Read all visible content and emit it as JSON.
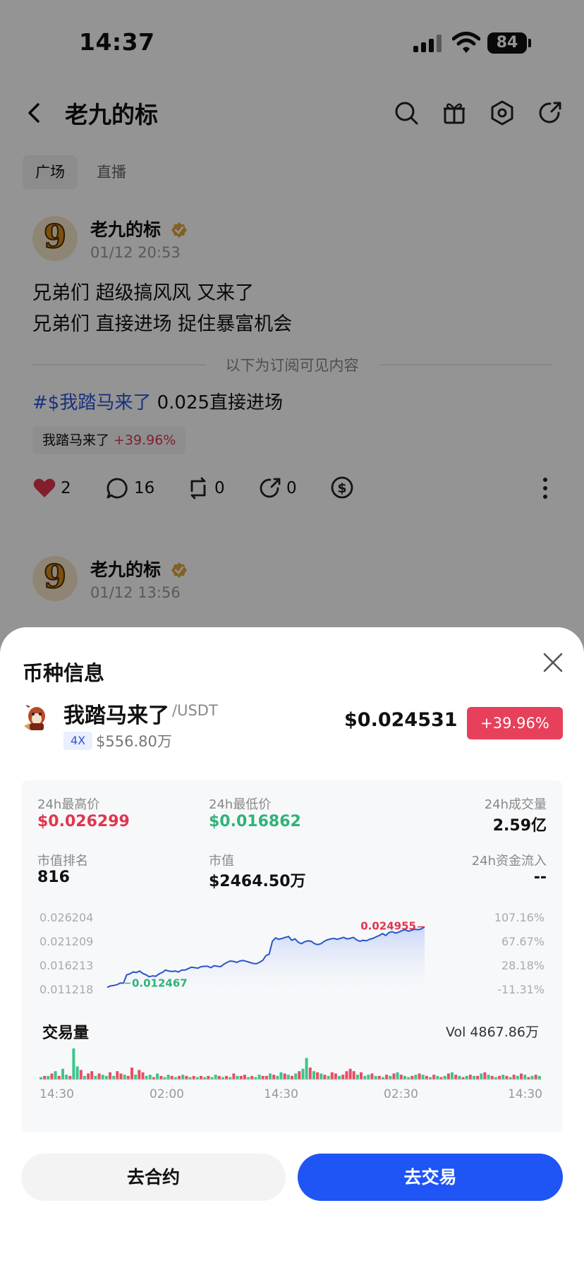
{
  "status_bar": {
    "time": "14:37",
    "battery": "84"
  },
  "header": {
    "title": "老九的标"
  },
  "tabs": [
    {
      "label": "广场",
      "active": true
    },
    {
      "label": "直播",
      "active": false
    }
  ],
  "posts": [
    {
      "author": "老九的标",
      "avatar_glyph": "9",
      "time": "01/12 20:53",
      "lines": [
        "兄弟们 超级搞风风 又来了",
        "兄弟们 直接进场 捉住暴富机会"
      ],
      "divider_text": "以下为订阅可见内容",
      "hashtag": "#$我踏马来了",
      "hashtag_suffix": " 0.025直接进场",
      "tag": {
        "name": "我踏马来了",
        "change": "+39.96%"
      },
      "stats": {
        "likes": "2",
        "comments": "16",
        "reposts": "0",
        "shares": "0"
      }
    },
    {
      "author": "老九的标",
      "avatar_glyph": "9",
      "time": "01/12 13:56"
    }
  ],
  "sheet": {
    "title": "币种信息",
    "coin": {
      "name": "我踏马来了",
      "pair": "/USDT",
      "leverage": "4X",
      "market_cap_short": "$556.80万",
      "price": "$0.024531",
      "change": "+39.96%"
    },
    "stats": {
      "high_label": "24h最高价",
      "high_value": "$0.026299",
      "low_label": "24h最低价",
      "low_value": "$0.016862",
      "volume_label": "24h成交量",
      "volume_value": "2.59亿",
      "rank_label": "市值排名",
      "rank_value": "816",
      "mcap_label": "市值",
      "mcap_value": "$2464.50万",
      "flow_label": "24h资金流入",
      "flow_value": "--"
    },
    "volume": {
      "title": "交易量",
      "text": "Vol 4867.86万"
    },
    "buttons": {
      "contract": "去合约",
      "trade": "去交易"
    }
  },
  "colors": {
    "up": "#e0364f",
    "down": "#2fb378",
    "accent": "#1f54f5",
    "line": "#2a55c8"
  },
  "chart_data": [
    {
      "type": "area",
      "y_ticks_left": [
        "0.026204",
        "0.021209",
        "0.016213",
        "0.011218"
      ],
      "y_ticks_right": [
        "107.16%",
        "67.67%",
        "28.18%",
        "-11.31%"
      ],
      "ylim": [
        0.011218,
        0.026204
      ],
      "annotations": [
        {
          "label": "0.024955",
          "kind": "high"
        },
        {
          "label": "0.012467",
          "kind": "low"
        }
      ],
      "series": [
        {
          "values": [
            0.0116,
            0.0119,
            0.012,
            0.01215,
            0.0125,
            0.01247,
            0.0142,
            0.0144,
            0.0148,
            0.0147,
            0.015,
            0.0145,
            0.0142,
            0.0138,
            0.014,
            0.0139,
            0.0144,
            0.0147,
            0.0152,
            0.015,
            0.0149,
            0.015,
            0.0148,
            0.0152,
            0.0152,
            0.0155,
            0.0158,
            0.0157,
            0.0156,
            0.0159,
            0.016,
            0.016,
            0.0157,
            0.0161,
            0.016,
            0.0159,
            0.0164,
            0.0168,
            0.0171,
            0.017,
            0.0168,
            0.0171,
            0.0172,
            0.017,
            0.0168,
            0.0166,
            0.0165,
            0.0168,
            0.0172,
            0.0182,
            0.0185,
            0.0212,
            0.0219,
            0.0216,
            0.0218,
            0.022,
            0.0222,
            0.0214,
            0.0217,
            0.021,
            0.0207,
            0.0211,
            0.0213,
            0.0212,
            0.0207,
            0.0205,
            0.0207,
            0.0212,
            0.0215,
            0.0217,
            0.0218,
            0.0216,
            0.0218,
            0.022,
            0.0217,
            0.0218,
            0.022,
            0.0215,
            0.0212,
            0.0214,
            0.0213,
            0.0216,
            0.0218,
            0.0221,
            0.0224,
            0.0228,
            0.0224,
            0.023,
            0.0232,
            0.0229,
            0.0231,
            0.0234,
            0.0236,
            0.0233,
            0.0235,
            0.0237,
            0.0236,
            0.0238,
            0.0242
          ]
        }
      ]
    },
    {
      "type": "bar",
      "title": "交易量",
      "x_tick_labels": [
        "14:30",
        "02:00",
        "14:30",
        "02:30",
        "14:30"
      ],
      "values": [
        2,
        3,
        3,
        5,
        7,
        3,
        9,
        4,
        3,
        26,
        11,
        8,
        3,
        5,
        7,
        3,
        5,
        4,
        3,
        6,
        3,
        7,
        5,
        4,
        3,
        10,
        4,
        8,
        6,
        3,
        4,
        2,
        5,
        3,
        2,
        4,
        3,
        2,
        3,
        4,
        3,
        2,
        3,
        2,
        3,
        2,
        3,
        2,
        4,
        3,
        2,
        3,
        2,
        5,
        3,
        3,
        4,
        2,
        3,
        2,
        4,
        3,
        3,
        5,
        4,
        3,
        6,
        5,
        4,
        3,
        5,
        7,
        9,
        18,
        10,
        7,
        6,
        5,
        4,
        3,
        6,
        5,
        3,
        4,
        7,
        9,
        7,
        4,
        6,
        3,
        4,
        5,
        3,
        3,
        2,
        4,
        3,
        5,
        6,
        4,
        3,
        2,
        3,
        4,
        5,
        4,
        3,
        2,
        4,
        3,
        2,
        3,
        5,
        6,
        4,
        3,
        2,
        3,
        4,
        3,
        3,
        5,
        6,
        4,
        3,
        2,
        3,
        4,
        3,
        2,
        4,
        3,
        5,
        4,
        2,
        3,
        4,
        3
      ],
      "directions": [
        "g",
        "r",
        "g",
        "r",
        "g",
        "r",
        "g",
        "g",
        "r",
        "g",
        "g",
        "r",
        "g",
        "r",
        "r",
        "g",
        "r",
        "g",
        "g",
        "r",
        "g",
        "r",
        "r",
        "g",
        "r",
        "r",
        "g",
        "r",
        "r",
        "g",
        "g",
        "r",
        "g",
        "r",
        "g",
        "g",
        "r",
        "g",
        "r",
        "g",
        "r",
        "g",
        "r",
        "g",
        "r",
        "g",
        "r",
        "g",
        "g",
        "r",
        "g",
        "r",
        "g",
        "r",
        "g",
        "r",
        "r",
        "g",
        "r",
        "g",
        "g",
        "r",
        "r",
        "g",
        "r",
        "g",
        "g",
        "r",
        "g",
        "r",
        "g",
        "r",
        "g",
        "g",
        "r",
        "g",
        "r",
        "g",
        "r",
        "g",
        "r",
        "r",
        "g",
        "r",
        "r",
        "r",
        "r",
        "g",
        "r",
        "g",
        "g",
        "r",
        "g",
        "r",
        "g",
        "r",
        "g",
        "r",
        "g",
        "r",
        "g",
        "g",
        "r",
        "g",
        "r",
        "g",
        "r",
        "g",
        "r",
        "g",
        "r",
        "g",
        "r",
        "g",
        "r",
        "g",
        "r",
        "g",
        "r",
        "g",
        "r",
        "g",
        "r",
        "g",
        "r",
        "g",
        "r",
        "g",
        "r",
        "g",
        "r",
        "g",
        "r",
        "g",
        "r",
        "g",
        "r",
        "g"
      ]
    }
  ]
}
